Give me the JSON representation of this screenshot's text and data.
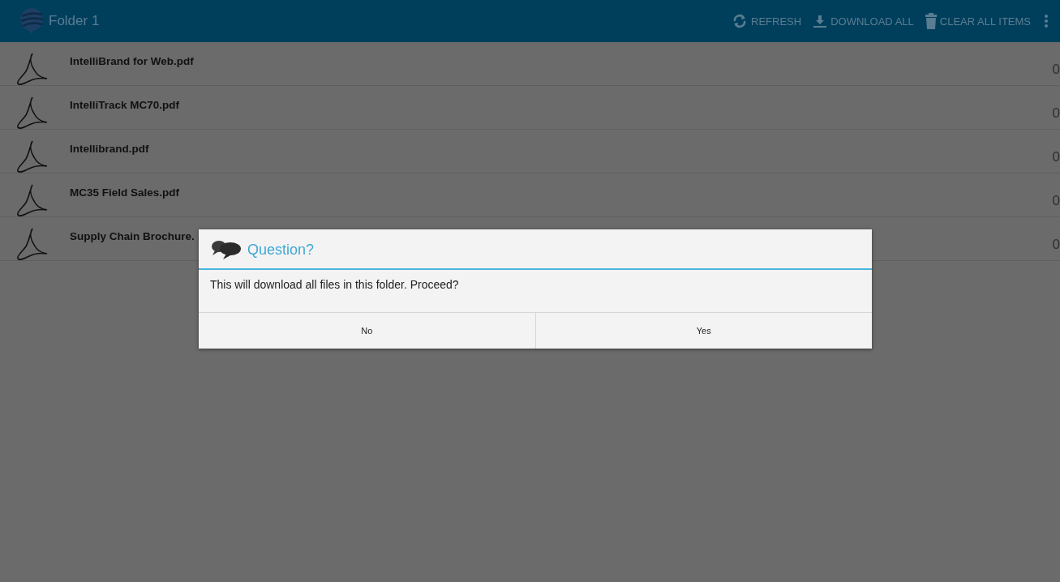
{
  "action_bar": {
    "title": "Folder 1",
    "actions": [
      {
        "kind": "refresh",
        "label": "REFRESH"
      },
      {
        "kind": "download",
        "label": "DOWNLOAD ALL"
      },
      {
        "kind": "trash",
        "label": "CLEAR ALL ITEMS"
      }
    ]
  },
  "files": [
    {
      "name": "IntelliBrand for Web.pdf",
      "count": "0"
    },
    {
      "name": "IntelliTrack MC70.pdf",
      "count": "0"
    },
    {
      "name": "Intellibrand.pdf",
      "count": "0"
    },
    {
      "name": "MC35 Field Sales.pdf",
      "count": "0"
    },
    {
      "name": "Supply Chain Brochure.",
      "count": "0"
    }
  ],
  "dialog": {
    "title": "Question?",
    "message": "This will download all files in this folder. Proceed?",
    "buttons": [
      "No",
      "Yes"
    ]
  }
}
